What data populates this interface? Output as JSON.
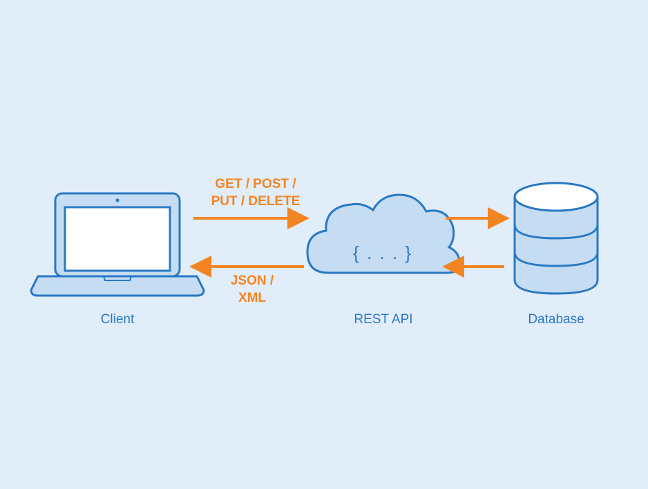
{
  "nodes": {
    "client": {
      "label": "Client"
    },
    "api": {
      "label": "REST API",
      "symbol": "{ . . . }"
    },
    "database": {
      "label": "Database"
    }
  },
  "arrows": {
    "request_label_1": "GET / POST /",
    "request_label_2": "PUT / DELETE",
    "response_label_1": "JSON /",
    "response_label_2": "XML"
  },
  "colors": {
    "bg": "#e1edf9",
    "stroke": "#2878c4",
    "lightfill": "#c5dcf2",
    "white": "#ffffff",
    "orange": "#f28522"
  }
}
